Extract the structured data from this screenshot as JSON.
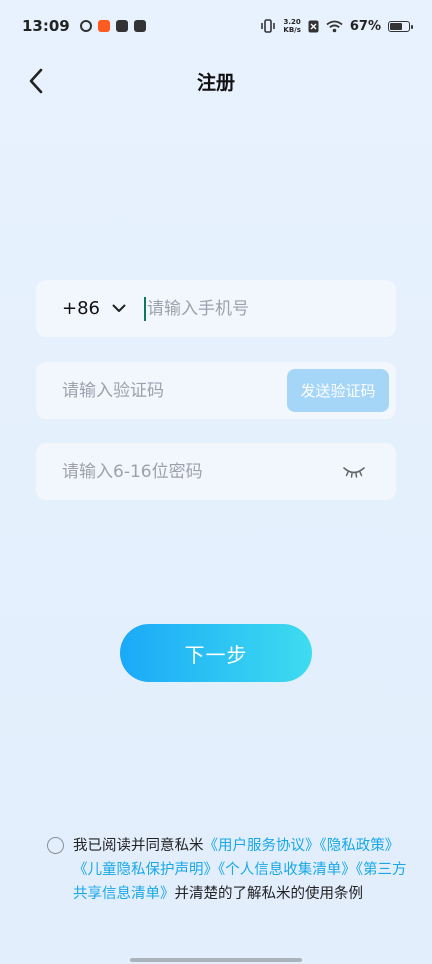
{
  "status_bar": {
    "time": "13:09",
    "speed_value": "3.20",
    "speed_unit": "KB/s",
    "battery": "67%"
  },
  "header": {
    "title": "注册"
  },
  "form": {
    "country_code": "+86",
    "phone_placeholder": "请输入手机号",
    "code_placeholder": "请输入验证码",
    "send_code_label": "发送验证码",
    "password_placeholder": "请输入6-16位密码"
  },
  "next_button": "下一步",
  "agreement": {
    "prefix": "我已阅读并同意私米",
    "link_user_service": "《用户服务协议》",
    "link_privacy_policy": "《隐私政策》",
    "link_children_privacy": "《儿童隐私保护声明》",
    "link_personal_info": "《个人信息收集清单》",
    "link_third_party": "《第三方共享信息清单》",
    "suffix": "并清楚的了解私米的使用条例"
  },
  "colors": {
    "accent": "#18a7e8",
    "send_button": "#a6d6f7",
    "next_gradient_start": "#1ba9f8",
    "next_gradient_end": "#3edcef"
  }
}
